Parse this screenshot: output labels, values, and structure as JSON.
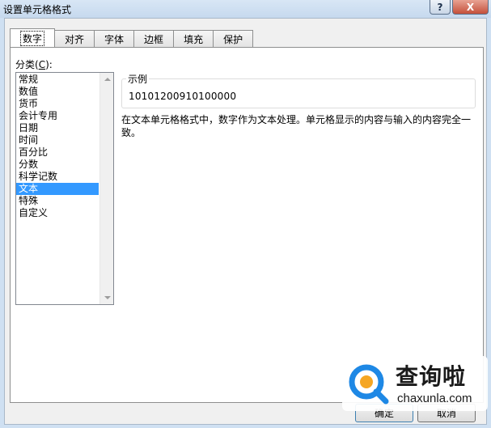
{
  "window": {
    "title": "设置单元格格式",
    "help_label": "?",
    "close_label": "X"
  },
  "tabs": [
    {
      "label": "数字",
      "active": true
    },
    {
      "label": "对齐",
      "active": false
    },
    {
      "label": "字体",
      "active": false
    },
    {
      "label": "边框",
      "active": false
    },
    {
      "label": "填充",
      "active": false
    },
    {
      "label": "保护",
      "active": false
    }
  ],
  "category": {
    "label_prefix": "分类(",
    "label_key": "C",
    "label_suffix": "):",
    "items": [
      "常规",
      "数值",
      "货币",
      "会计专用",
      "日期",
      "时间",
      "百分比",
      "分数",
      "科学记数",
      "文本",
      "特殊",
      "自定义"
    ],
    "selected": "文本"
  },
  "sample": {
    "legend": "示例",
    "value": "10101200910100000"
  },
  "description": "在文本单元格格式中，数字作为文本处理。单元格显示的内容与输入的内容完全一致。",
  "watermark": {
    "title": "查询啦",
    "subtitle": "chaxunla.com"
  },
  "buttons": {
    "ok": "确定",
    "cancel": "取消"
  },
  "colors": {
    "selection": "#3399ff",
    "watermark_blue": "#1e88e5",
    "watermark_orange": "#f5a623"
  }
}
